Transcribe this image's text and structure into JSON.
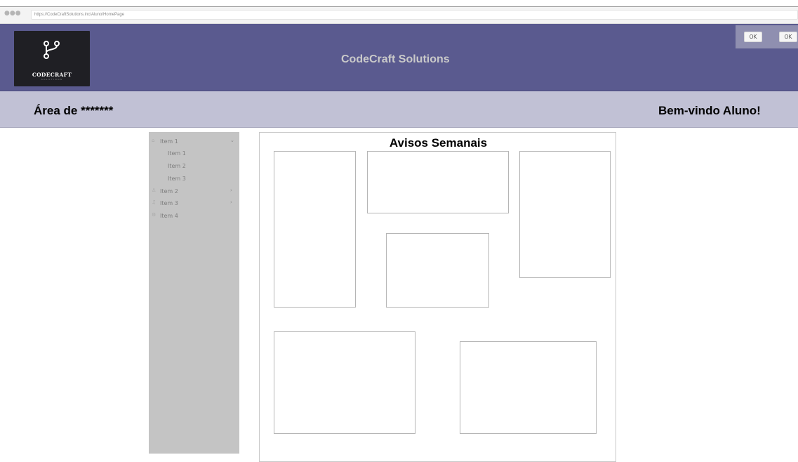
{
  "browser": {
    "dots": "●●●",
    "url": "https://CodeCraftSolutions.inc/Aluno/HomePage"
  },
  "header": {
    "logo_text": "CODECRAFT",
    "logo_subtext": "SOLUTIONS",
    "title": "CodeCraft Solutions",
    "ok_button_1": "OK",
    "ok_button_2": "OK",
    "colors": {
      "header_bg": "#5a5a8f",
      "subheader_bg": "#c1c1d5",
      "sidebar_bg": "#c4c4c4"
    }
  },
  "subheader": {
    "area_label": "Área de *******",
    "welcome": "Bem-vindo Aluno!"
  },
  "sidebar": {
    "items": [
      {
        "label": "Item 1",
        "icon": "home-icon",
        "glyph": "⌂",
        "chevron": "⌄",
        "expanded": true,
        "children": [
          "Item 1",
          "Item 2",
          "Item 3"
        ]
      },
      {
        "label": "Item 2",
        "icon": "user-icon",
        "glyph": "♙",
        "chevron": "›"
      },
      {
        "label": "Item 3",
        "icon": "bell-icon",
        "glyph": "♫",
        "chevron": "›"
      },
      {
        "label": "Item 4",
        "icon": "settings-icon",
        "glyph": "⚙",
        "chevron": ""
      }
    ]
  },
  "main": {
    "title": "Avisos Semanais"
  }
}
